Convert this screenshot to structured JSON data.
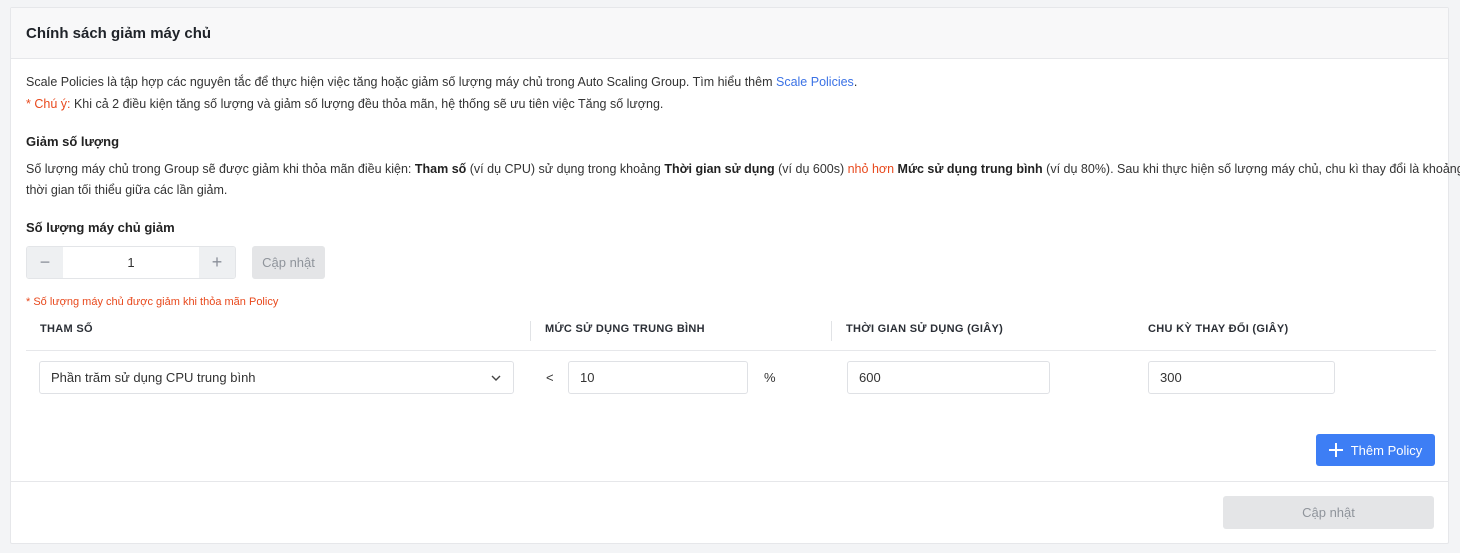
{
  "card": {
    "title": "Chính sách giảm máy chủ"
  },
  "intro": {
    "text": "Scale Policies là tập hợp các nguyên tắc để thực hiện việc tăng hoặc giảm số lượng máy chủ trong Auto Scaling Group. Tìm hiểu thêm ",
    "link": "Scale Policies",
    "end": ".",
    "note_prefix": "* Chú ý:",
    "note_text": " Khi cả 2 điều kiện tăng số lượng và giảm số lượng đều thỏa mãn, hệ thống sẽ ưu tiên việc Tăng số lượng."
  },
  "decrease": {
    "title": "Giảm số lượng",
    "desc_1": "Số lượng máy chủ trong Group sẽ được giảm khi thỏa mãn điều kiện: ",
    "desc_b1": "Tham số",
    "desc_2": " (ví dụ CPU) sử dụng trong khoảng ",
    "desc_b2": "Thời gian sử dụng",
    "desc_3": " (ví dụ 600s) ",
    "desc_red": "nhỏ hơn",
    "desc_4": " ",
    "desc_b3": "Mức sử dụng trung bình",
    "desc_5": " (ví dụ 80%). Sau khi thực hiện số lượng máy chủ, chu kì thay đổi là khoảng",
    "desc_6": "thời gian tối thiểu giữa các lần giảm."
  },
  "stepper": {
    "label": "Số lượng máy chủ giảm",
    "minus": "−",
    "value": "1",
    "plus": "+",
    "update_label": "Cập nhật",
    "note": "* Số lượng máy chủ được giảm khi thỏa mãn Policy"
  },
  "table": {
    "headers": [
      "THAM SỐ",
      "MỨC SỬ DỤNG TRUNG BÌNH",
      "THỜI GIAN SỬ DỤNG (GIÂY)",
      "CHU KỲ THAY ĐỔI (GIÂY)"
    ],
    "row": {
      "param": "Phần trăm sử dụng CPU trung bình",
      "operator": "<",
      "avg": "10",
      "unit": "%",
      "duration": "600",
      "cycle": "300"
    }
  },
  "add_policy_label": "Thêm Policy",
  "footer": {
    "update_label": "Cập nhật"
  },
  "colors": {
    "primary": "#3d7ef5",
    "link": "#3b72e5",
    "warning": "#e8491d"
  }
}
